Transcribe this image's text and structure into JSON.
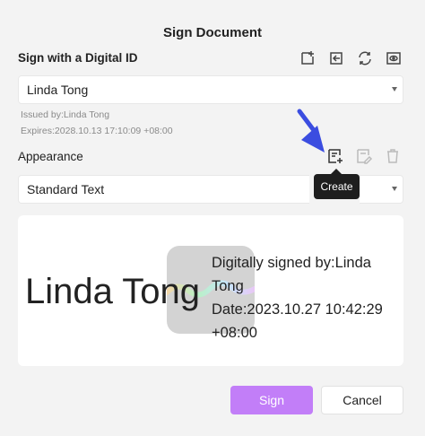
{
  "dialog": {
    "title": "Sign Document"
  },
  "digital_id": {
    "section_label": "Sign with a Digital ID",
    "selected": "Linda Tong",
    "issued_by": "Issued by:Linda Tong",
    "expires": "Expires:2028.10.13 17:10:09 +08:00",
    "toolbar_icons": [
      "add-id-icon",
      "import-id-icon",
      "refresh-icon",
      "view-id-icon"
    ]
  },
  "appearance": {
    "section_label": "Appearance",
    "selected": "Standard Text",
    "toolbar_icons": [
      "create-appearance-icon",
      "edit-appearance-icon",
      "delete-appearance-icon"
    ],
    "tooltip": "Create"
  },
  "preview": {
    "signer_name": "Linda Tong",
    "detail_lines": [
      "Digitally signed by:Linda",
      "Tong",
      "Date:2023.10.27 10:42:29",
      "+08:00"
    ]
  },
  "buttons": {
    "sign": "Sign",
    "cancel": "Cancel"
  },
  "colors": {
    "accent": "#c27ef8",
    "annotation_arrow": "#3b4de0",
    "tooltip_bg": "#1e1e1e"
  }
}
